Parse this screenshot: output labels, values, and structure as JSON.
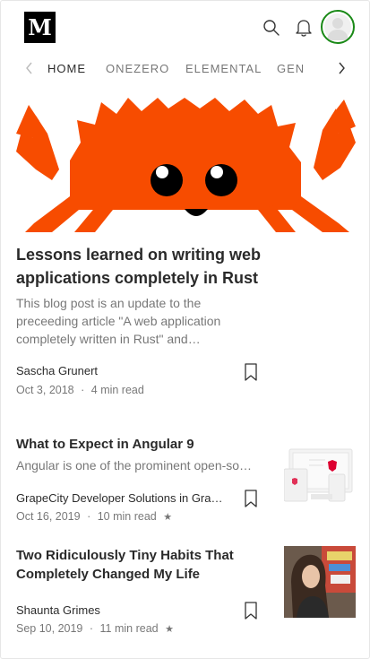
{
  "header": {
    "logo": "M",
    "icons": [
      "search-icon",
      "bell-icon",
      "avatar"
    ]
  },
  "tabs": {
    "items": [
      "HOME",
      "ONEZERO",
      "ELEMENTAL",
      "GEN"
    ],
    "active": "HOME"
  },
  "posts": [
    {
      "title": "Lessons learned on writing web applications completely in Rust",
      "excerpt": "This blog post is an update to the preceeding article \"A web application completely written in Rust\" and…",
      "author": "Sascha Grunert",
      "date": "Oct 3, 2018",
      "read_time": "4 min read",
      "starred": false,
      "image": "rust-crab"
    },
    {
      "title": "What to Expect in Angular 9",
      "excerpt": "Angular is one of the prominent open-source…",
      "author": "GrapeCity Developer Solutions in GrapeCity",
      "date": "Oct 16, 2019",
      "read_time": "10 min read",
      "starred": true,
      "image": "angular-devices"
    },
    {
      "title": "Two Ridiculously Tiny Habits That Completely Changed My Life",
      "excerpt": "",
      "author": "Shaunta Grimes",
      "date": "Sep 10, 2019",
      "read_time": "11 min read",
      "starred": true,
      "image": "woman-portrait"
    }
  ],
  "separator": "·",
  "star_glyph": "★",
  "colors": {
    "crab": "#f74c00",
    "accent_green": "#1a8917"
  }
}
